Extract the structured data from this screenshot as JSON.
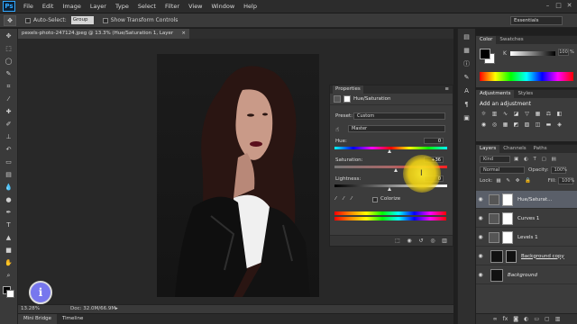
{
  "app": {
    "logo": "Ps"
  },
  "menu": [
    "File",
    "Edit",
    "Image",
    "Layer",
    "Type",
    "Select",
    "Filter",
    "View",
    "Window",
    "Help"
  ],
  "options": {
    "auto_select_label": "Auto-Select:",
    "auto_select_value": "Group",
    "transform_label": "Show Transform Controls",
    "workspace": "Essentials"
  },
  "document": {
    "tab_title": "pexels-photo-247124.jpeg @ 13.3% (Hue/Saturation 1, Layer Mask/8) *",
    "zoom": "13.28%",
    "doc_size": "Doc: 32.0M/66.9M"
  },
  "bottom_tabs": [
    "Mini Bridge",
    "Timeline"
  ],
  "properties": {
    "tab": "Properties",
    "title": "Hue/Saturation",
    "preset_label": "Preset:",
    "preset_value": "Custom",
    "channel_value": "Master",
    "hue_label": "Hue:",
    "hue_value": "0",
    "saturation_label": "Saturation:",
    "saturation_value": "+36",
    "lightness_label": "Lightness:",
    "lightness_value": "0",
    "colorize_label": "Colorize"
  },
  "color_panel": {
    "tabs": [
      "Color",
      "Swatches"
    ],
    "k_label": "K",
    "k_value": "100",
    "k_unit": "%"
  },
  "adjustments_panel": {
    "tabs": [
      "Adjustments",
      "Styles"
    ],
    "title": "Add an adjustment"
  },
  "layers_panel": {
    "tabs": [
      "Layers",
      "Channels",
      "Paths"
    ],
    "kind_value": "Kind",
    "blend_mode": "Normal",
    "opacity_label": "Opacity:",
    "opacity_value": "100%",
    "lock_label": "Lock:",
    "fill_label": "Fill:",
    "fill_value": "100%",
    "layers": [
      {
        "name": "Hue/Saturat...",
        "type": "adjustment",
        "selected": true
      },
      {
        "name": "Curves 1",
        "type": "adjustment",
        "selected": false
      },
      {
        "name": "Levels 1",
        "type": "adjustment",
        "selected": false
      },
      {
        "name": "Background copy",
        "type": "image",
        "selected": false
      },
      {
        "name": "Background",
        "type": "image",
        "selected": false
      }
    ]
  },
  "tutorial_logo": "i"
}
